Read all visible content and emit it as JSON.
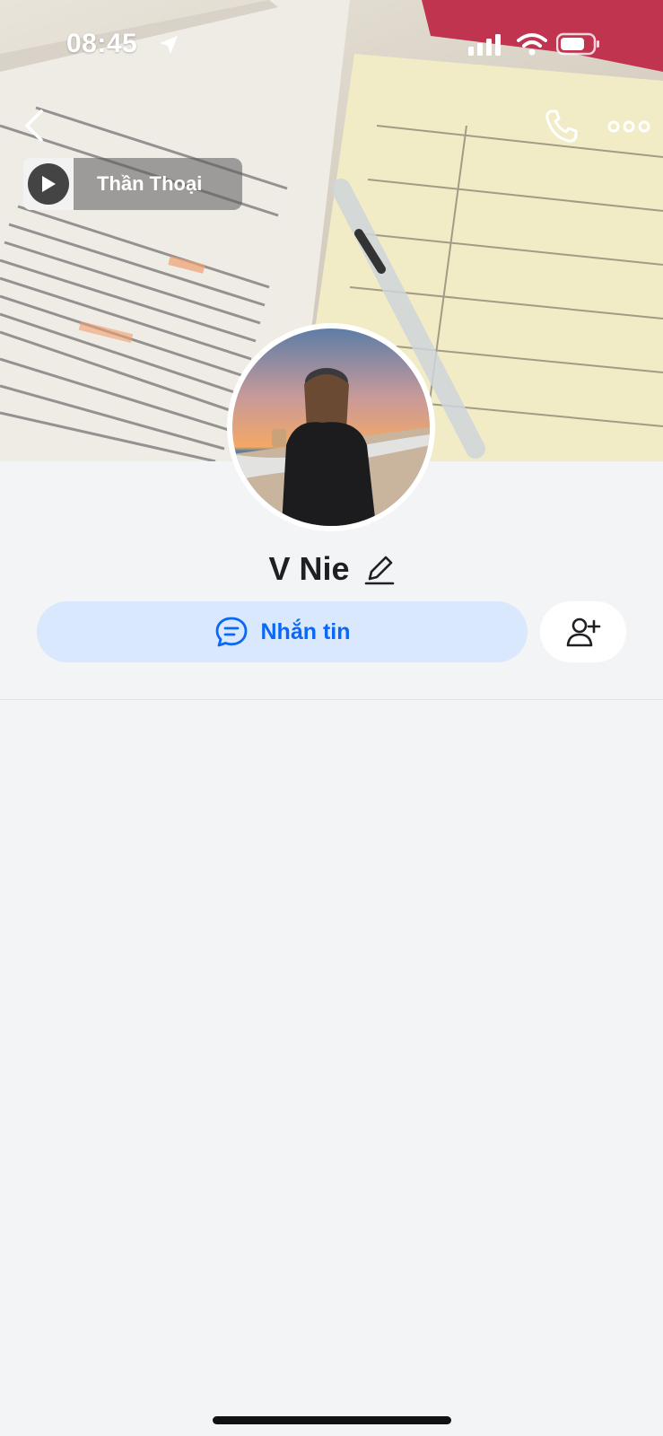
{
  "status_bar": {
    "time": "08:45",
    "icons": [
      "location-arrow-icon",
      "cellular-signal-icon",
      "wifi-icon",
      "battery-icon"
    ]
  },
  "header": {
    "icons": [
      "back-arrow-icon",
      "phone-icon",
      "more-options-icon"
    ]
  },
  "music": {
    "title": "Thần Thoại",
    "icon": "play-icon"
  },
  "profile": {
    "name": "V Nie",
    "edit_icon": "pencil-icon"
  },
  "actions": {
    "message_label": "Nhắn tin",
    "message_icon": "chat-bubble-icon",
    "add_friend_icon": "add-user-icon"
  },
  "colors": {
    "accent": "#0a68f5",
    "accent_bg": "#d9e8fd",
    "background": "#f3f4f6",
    "text": "#1f2024"
  }
}
